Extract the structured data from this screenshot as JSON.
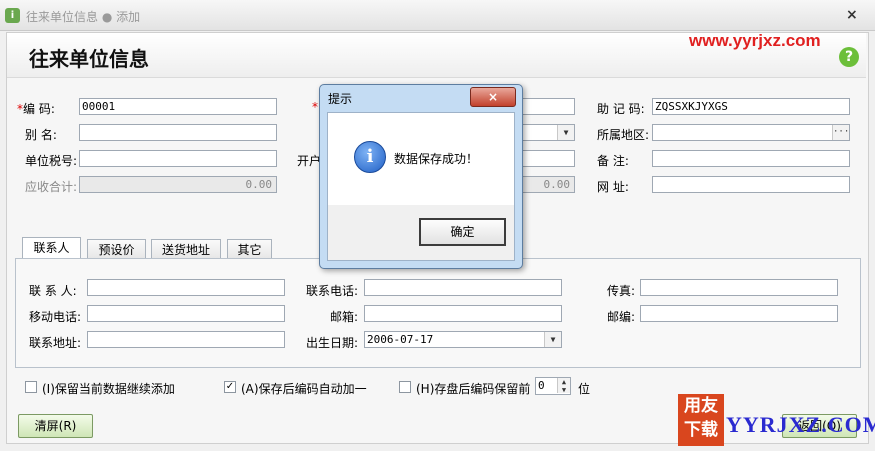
{
  "window": {
    "title": "往来单位信息 ● 添加",
    "close_label": "×"
  },
  "header": {
    "title": "往来单位信息",
    "help_label": "?"
  },
  "watermark": {
    "url": "www.yyrjxz.com",
    "logo_text": "用友下载",
    "logo_suffix": "YYRJXZ.COM"
  },
  "form": {
    "code_label": "编    码:",
    "code_value": "00001",
    "alias_label": "别    名:",
    "alias_value": "",
    "taxno_label": "单位税号:",
    "taxno_value": "",
    "receivable_label": "应收合计:",
    "receivable_value": "0.00",
    "openbank_label": "开户",
    "mid_receivable_value": "0.00",
    "mnemonic_label": "助 记 码:",
    "mnemonic_value": "ZQSSXKJYXGS",
    "region_label": "所属地区:",
    "region_value": "",
    "region_button": "···",
    "note_label": "备    注:",
    "note_value": "",
    "web_label": "网    址:",
    "web_value": "",
    "required_mark": "*"
  },
  "tabs": [
    {
      "label": "联系人",
      "active": true
    },
    {
      "label": "预设价",
      "active": false
    },
    {
      "label": "送货地址",
      "active": false
    },
    {
      "label": "其它",
      "active": false
    }
  ],
  "contact": {
    "person_label": "联 系 人:",
    "person_value": "",
    "mobile_label": "移动电话:",
    "mobile_value": "",
    "address_label": "联系地址:",
    "address_value": "",
    "phone_label": "联系电话:",
    "phone_value": "",
    "email_label": "邮箱:",
    "email_value": "",
    "birth_label": "出生日期:",
    "birth_value": "2006-07-17",
    "fax_label": "传真:",
    "fax_value": "",
    "zip_label": "邮编:",
    "zip_value": ""
  },
  "options": {
    "keep_data_label": "(I)保留当前数据继续添加",
    "keep_data_checked": false,
    "auto_increment_label": "(A)保存后编码自动加一",
    "auto_increment_checked": true,
    "keep_code_label": "(H)存盘后编码保留前",
    "keep_code_checked": false,
    "keep_digits_value": "0",
    "digits_unit": "位"
  },
  "buttons": {
    "clear_label": "清屏(R)",
    "return_label": "返回(Q)"
  },
  "dialog": {
    "title": "提示",
    "close_label": "×",
    "message": "数据保存成功！",
    "ok_label": "确定",
    "icon": "info-icon"
  },
  "colors": {
    "accent_green": "#6cbf3a",
    "watermark_red": "#e02020",
    "dialog_frame": "#c4dcf3"
  }
}
